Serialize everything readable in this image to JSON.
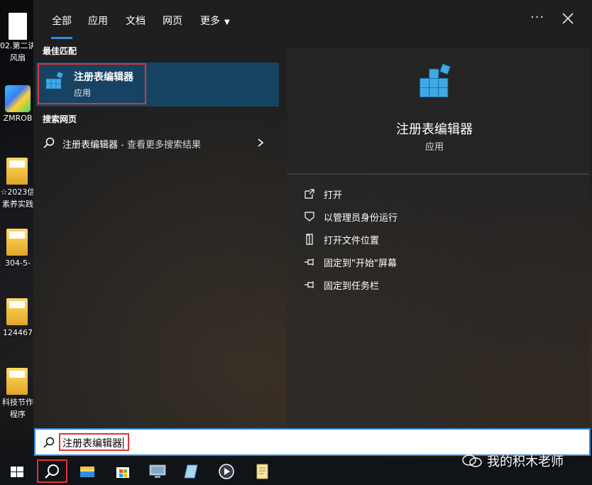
{
  "desktop": {
    "icons": [
      {
        "label_line1": "02.第二讲",
        "label_line2": "风扇"
      },
      {
        "label_line1": "ZMROB",
        "label_line2": ""
      },
      {
        "label_line1": "☆2023信",
        "label_line2": "素养实践"
      },
      {
        "label_line1": "304-5-",
        "label_line2": ""
      },
      {
        "label_line1": "124467",
        "label_line2": ""
      },
      {
        "label_line1": "科技节作",
        "label_line2": "程序"
      }
    ]
  },
  "start_menu": {
    "tabs": [
      {
        "label": "全部",
        "active": true
      },
      {
        "label": "应用"
      },
      {
        "label": "文档"
      },
      {
        "label": "网页"
      },
      {
        "label": "更多"
      }
    ],
    "more_options_label": "···",
    "best_match": {
      "section_title": "最佳匹配",
      "name": "注册表编辑器",
      "type": "应用"
    },
    "web_search": {
      "section_title": "搜索网页",
      "query": "注册表编辑器",
      "suffix": " - 查看更多搜索结果"
    },
    "detail": {
      "name": "注册表编辑器",
      "type": "应用",
      "actions": [
        {
          "label": "打开",
          "icon": "open-icon"
        },
        {
          "label": "以管理员身份运行",
          "icon": "shield-icon"
        },
        {
          "label": "打开文件位置",
          "icon": "file-location-icon"
        },
        {
          "label": "固定到\"开始\"屏幕",
          "icon": "pin-icon"
        },
        {
          "label": "固定到任务栏",
          "icon": "pin-icon"
        }
      ]
    }
  },
  "search": {
    "value": "注册表编辑器"
  },
  "taskbar": {
    "items": [
      "windows-start-icon",
      "search-icon",
      "file-explorer-icon",
      "microsoft-store-icon",
      "remote-desktop-icon",
      "notepad-app-icon",
      "media-player-icon",
      "notes-file-icon"
    ]
  },
  "watermark": {
    "text": "我的积木老师"
  },
  "colors": {
    "accent": "#2f8de0",
    "highlight_red": "#e53238",
    "selected_item": "#164361",
    "panel_bg": "#1f1f1f",
    "taskbar_bg": "#101317"
  }
}
